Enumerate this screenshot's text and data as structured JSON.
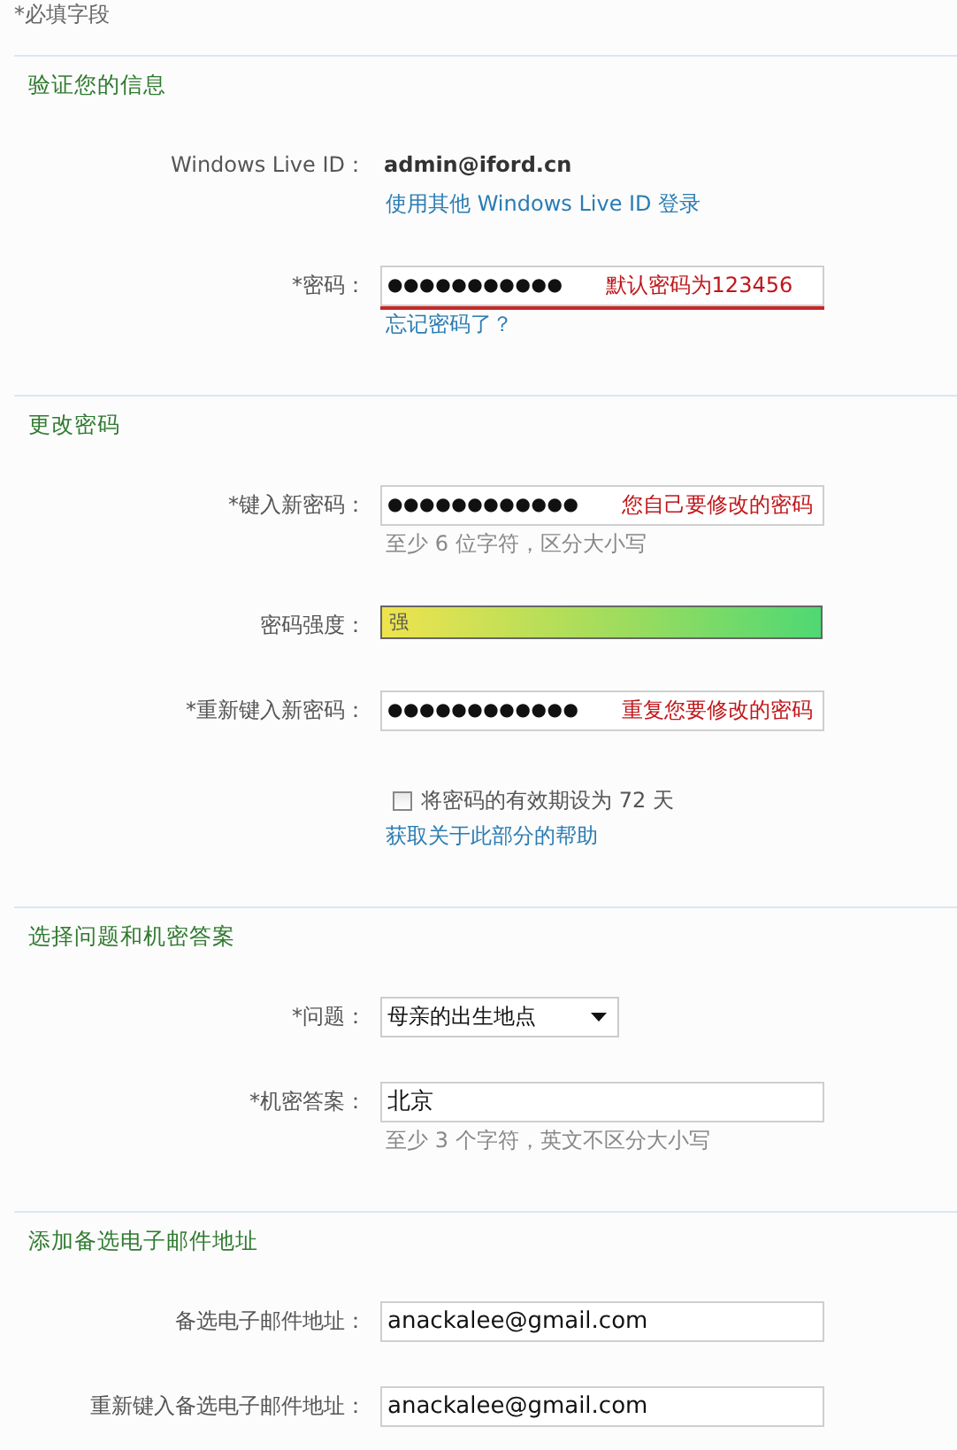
{
  "required_note": "*必填字段",
  "sections": [
    {
      "title": "验证您的信息",
      "rows": [
        {
          "kind": "static",
          "label": "Windows Live ID：",
          "value": "admin@iford.cn",
          "link": "使用其他 Windows Live ID 登录"
        },
        {
          "kind": "password",
          "label": "*密码：",
          "value": "●●●●●●●●●●●",
          "annotation": "默认密码为123456",
          "underlined": true,
          "link": "忘记密码了？"
        }
      ]
    },
    {
      "title": "更改密码",
      "rows": [
        {
          "kind": "password",
          "label": "*键入新密码：",
          "value": "●●●●●●●●●●●●",
          "annotation": "您自己要修改的密码",
          "underlined": false,
          "hint": "至少 6 位字符，区分大小写"
        },
        {
          "kind": "meter",
          "label": "密码强度：",
          "reading": "强",
          "level": 1
        },
        {
          "kind": "password",
          "label": "*重新键入新密码：",
          "value": "●●●●●●●●●●●●",
          "annotation": "重复您要修改的密码",
          "underlined": false
        },
        {
          "kind": "checkbox",
          "label": "将密码的有效期设为 72 天",
          "checked": false,
          "link": "获取关于此部分的帮助"
        }
      ]
    },
    {
      "title": "选择问题和机密答案",
      "rows": [
        {
          "kind": "select",
          "label": "*问题：",
          "value": "母亲的出生地点"
        },
        {
          "kind": "text",
          "label": "*机密答案：",
          "value": "北京",
          "hint": "至少 3 个字符，英文不区分大小写"
        }
      ]
    },
    {
      "title": "添加备选电子邮件地址",
      "rows": [
        {
          "kind": "text",
          "label": "备选电子邮件地址：",
          "value": "anackalee@gmail.com"
        },
        {
          "kind": "text",
          "label": "重新键入备选电子邮件地址：",
          "value": "anackalee@gmail.com"
        }
      ]
    }
  ]
}
